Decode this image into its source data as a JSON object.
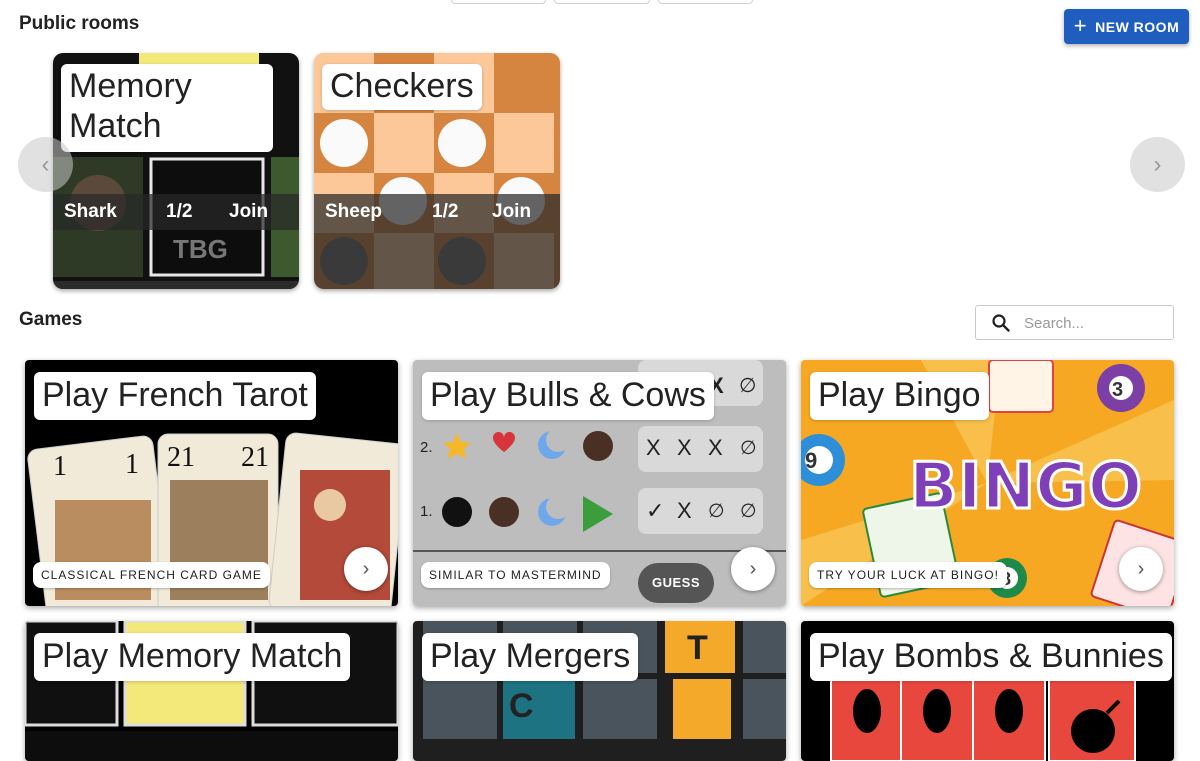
{
  "public_rooms": {
    "title": "Public rooms",
    "new_room_label": "NEW ROOM",
    "rooms": [
      {
        "game": "Memory Match",
        "game_line1": "Memory",
        "game_line2": "Match",
        "host": "Shark",
        "players": "1/2",
        "join_label": "Join"
      },
      {
        "game": "Checkers",
        "host": "Sheep",
        "players": "1/2",
        "join_label": "Join"
      }
    ],
    "prev_icon": "chevron-left-icon",
    "next_icon": "chevron-right-icon"
  },
  "games": {
    "title": "Games",
    "search_placeholder": "Search...",
    "items": [
      {
        "title": "Play French Tarot",
        "tag": "CLASSICAL FRENCH CARD GAME"
      },
      {
        "title": "Play Bulls & Cows",
        "tag": "SIMILAR TO MASTERMIND",
        "guess_label": "GUESS",
        "board_rows": [
          {
            "num": "2.",
            "marks": [
              "X",
              "X",
              "X",
              "∅"
            ]
          },
          {
            "num": "1.",
            "marks": [
              "✓",
              "X",
              "∅",
              "∅"
            ]
          }
        ],
        "top_marks": [
          "X",
          "∅"
        ]
      },
      {
        "title": "Play Bingo",
        "tag": "TRY YOUR LUCK AT BINGO!",
        "art_word": "BINGO",
        "balls": [
          "3",
          "9",
          "8"
        ]
      },
      {
        "title": "Play Memory Match"
      },
      {
        "title": "Play Mergers",
        "tiles": [
          "T",
          "C"
        ]
      },
      {
        "title": "Play Bombs & Bunnies"
      }
    ]
  },
  "colors": {
    "accent": "#1f5dbf",
    "checkers_light": "#fcc89a",
    "checkers_dark": "#d58540",
    "bingo_orange": "#f6a823"
  }
}
